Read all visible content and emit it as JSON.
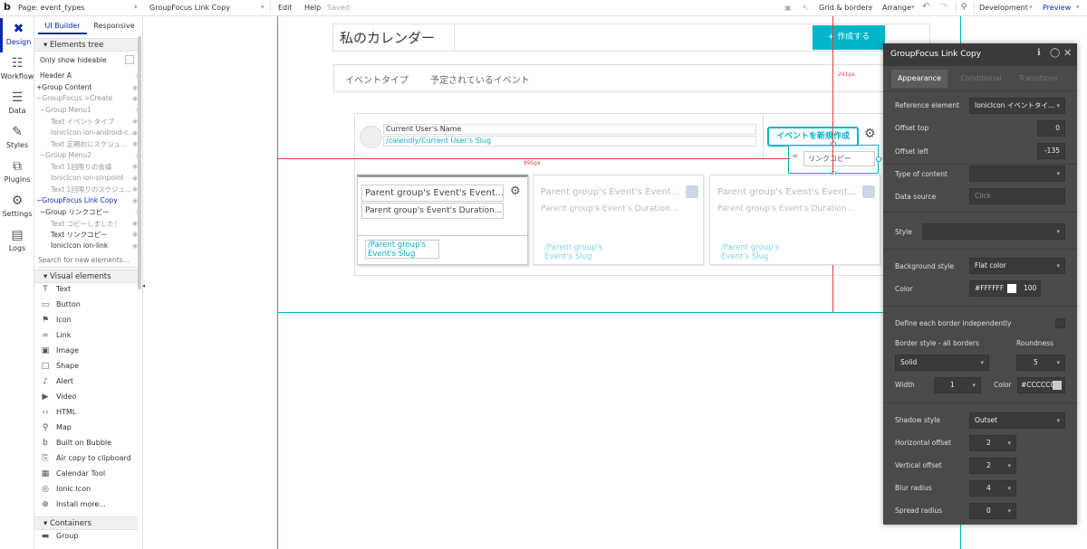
{
  "topbar": {
    "page_label": "Page: event_types",
    "element_label": "GroupFocus Link Copy",
    "edit": "Edit",
    "help": "Help",
    "saved": "Saved",
    "grid": "Grid & borders",
    "arrange": "Arrange",
    "development": "Development",
    "preview": "Preview"
  },
  "rail": [
    {
      "label": "Design",
      "icon": "design-icon"
    },
    {
      "label": "Workflow",
      "icon": "workflow-icon"
    },
    {
      "label": "Data",
      "icon": "data-icon"
    },
    {
      "label": "Styles",
      "icon": "styles-icon"
    },
    {
      "label": "Plugins",
      "icon": "plugins-icon"
    },
    {
      "label": "Settings",
      "icon": "settings-icon"
    },
    {
      "label": "Logs",
      "icon": "logs-icon"
    }
  ],
  "palette": {
    "tab_builder": "UI Builder",
    "tab_responsive": "Responsive",
    "elements_tree": "Elements tree",
    "only_hideable": "Only show hideable",
    "tree": [
      "Header A",
      "+Group Content",
      "−GroupFocus >Create",
      "−Group Menu1",
      "Text イベントタイプ",
      "IonicIcon ion-android-c...",
      "Text 定期的にスケジュ...",
      "−Group Menu2",
      "Text 1回限りの会議",
      "IonicIcon ion-pinpoint",
      "Text 1回限りのスケジュ...",
      "−GroupFocus Link Copy",
      "−Group リンクコピー",
      "Text コピーしました！",
      "Text リンクコピー",
      "IonicIcon ion-link"
    ],
    "search_placeholder": "Search for new elements...",
    "visual_elements": "Visual elements",
    "visual": [
      "Text",
      "Button",
      "Icon",
      "Link",
      "Image",
      "Shape",
      "Alert",
      "Video",
      "HTML",
      "Map",
      "Built on Bubble",
      "Air copy to clipboard",
      "Calendar Tool",
      "Ionic Icon",
      "Install more..."
    ],
    "containers": "Containers",
    "group": "Group"
  },
  "canvas": {
    "title": "私のカレンダー",
    "create_button": "+ 作成する",
    "tab1": "イベントタイプ",
    "tab2": "予定されているイベント",
    "user_name": "Current User's Name",
    "user_slug": "/calendly/Current User's Slug",
    "new_event_button": "イベントを新規作成",
    "link_copy": "リンクコピー",
    "card_title": "Parent group's Event's Event...",
    "card_duration": "Parent group's Event's Duration...",
    "card_slug": "/Parent group's Event's Slug",
    "dim_895": "895px",
    "dim_241": "241px",
    "dim_244": "244px"
  },
  "panel": {
    "title": "GroupFocus Link Copy",
    "tabs": [
      "Appearance",
      "Conditional",
      "Transitions"
    ],
    "reference_label": "Reference element",
    "reference_value": "IonicIcon イベントタイ...",
    "offset_top_label": "Offset top",
    "offset_top": "0",
    "offset_left_label": "Offset left",
    "offset_left": "-135",
    "type_label": "Type of content",
    "source_label": "Data source",
    "source_placeholder": "Click",
    "style_label": "Style",
    "bg_label": "Background style",
    "bg_value": "Flat color",
    "color_label": "Color",
    "color_value": "#FFFFFF",
    "opacity": "100",
    "border_indep": "Define each border independently",
    "border_style_label": "Border style - all borders",
    "roundness_label": "Roundness",
    "border_style": "Solid",
    "roundness": "5",
    "width_label": "Width",
    "width_value": "1",
    "bcolor_label": "Color",
    "bcolor_value": "#CCCCCC",
    "shadow_label": "Shadow style",
    "shadow_value": "Outset",
    "hoff_label": "Horizontal offset",
    "hoff": "2",
    "voff_label": "Vertical offset",
    "voff": "2",
    "blur_label": "Blur radius",
    "blur": "4",
    "spread_label": "Spread radius",
    "spread": "0"
  },
  "colors": {
    "accent": "#00b5c8",
    "brand": "#0c29ab",
    "guide": "#e04040",
    "panel": "#4a4a4a"
  }
}
